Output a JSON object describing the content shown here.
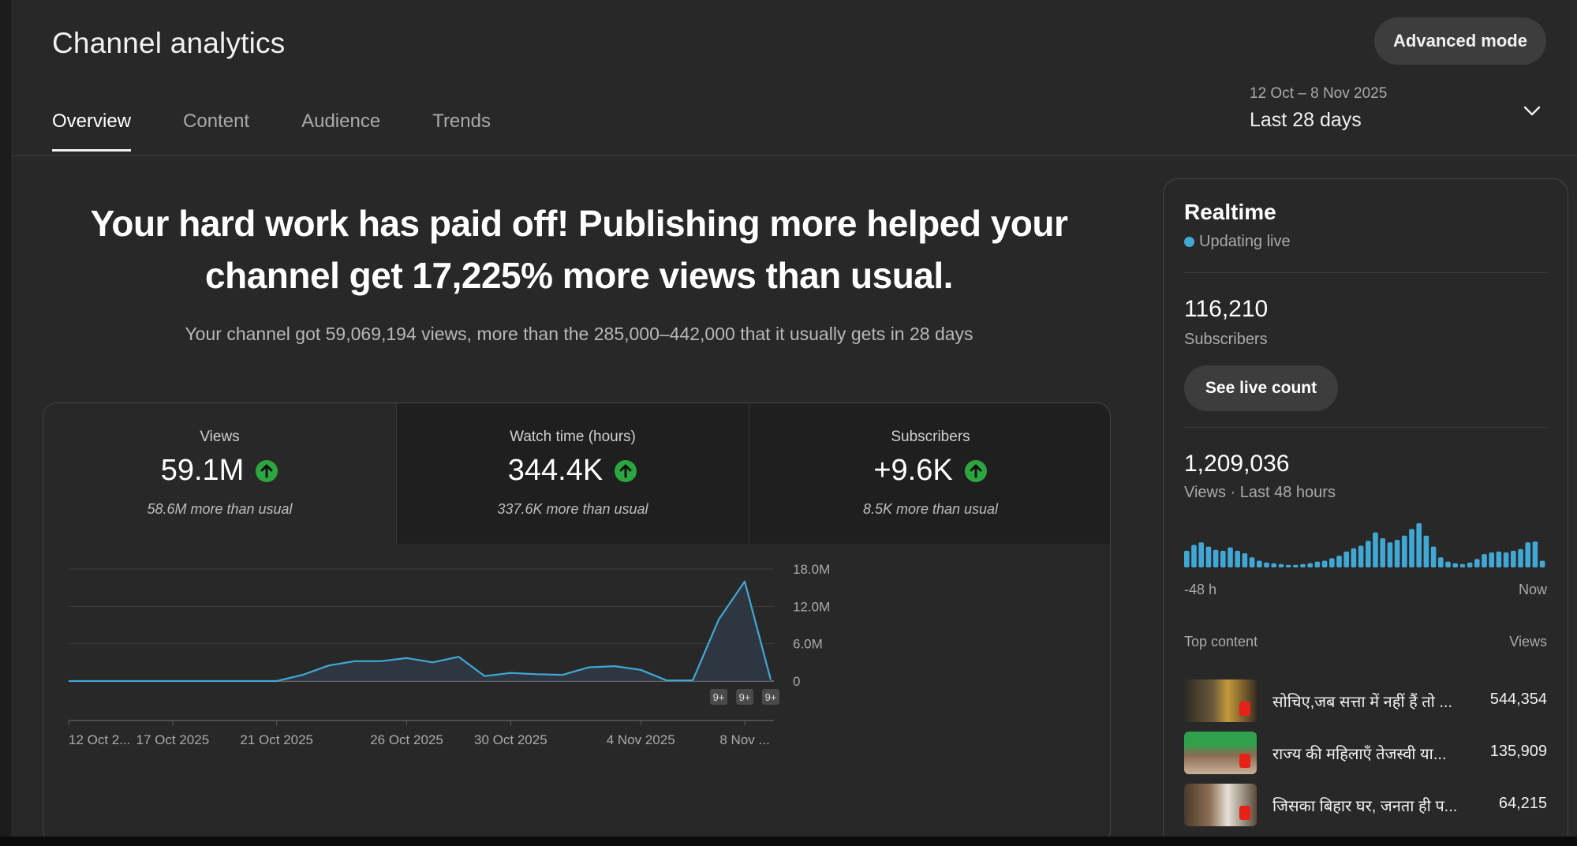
{
  "header": {
    "title": "Channel analytics",
    "advanced_label": "Advanced mode"
  },
  "tabs": [
    {
      "label": "Overview"
    },
    {
      "label": "Content"
    },
    {
      "label": "Audience"
    },
    {
      "label": "Trends"
    }
  ],
  "date": {
    "range": "12 Oct – 8 Nov 2025",
    "label": "Last 28 days"
  },
  "summary": {
    "headline_1": "Your hard work has paid off! Publishing more helped your",
    "headline_2": "channel get 17,225% more views than usual.",
    "subline": "Your channel got 59,069,194 views, more than the 285,000–442,000 that it usually gets in 28 days"
  },
  "metrics": [
    {
      "label": "Views",
      "value": "59.1M",
      "note": "58.6M more than usual"
    },
    {
      "label": "Watch time (hours)",
      "value": "344.4K",
      "note": "337.6K more than usual"
    },
    {
      "label": "Subscribers",
      "value": "+9.6K",
      "note": "8.5K more than usual"
    }
  ],
  "colors": {
    "accent": "#41a8d6",
    "up": "#2ba640",
    "background": "#282828"
  },
  "chart_data": {
    "type": "area",
    "ylim": [
      0,
      18000000
    ],
    "y_ticks": [
      0,
      6000000,
      12000000,
      18000000
    ],
    "y_tick_labels": [
      "0",
      "6.0M",
      "12.0M",
      "18.0M"
    ],
    "x_tick_labels": [
      "12 Oct 2...",
      "17 Oct 2025",
      "21 Oct 2025",
      "26 Oct 2025",
      "30 Oct 2025",
      "4 Nov 2025",
      "8 Nov ..."
    ],
    "x_tick_index": [
      0,
      4,
      8,
      13,
      17,
      22,
      26
    ],
    "values": [
      0,
      0,
      0,
      0,
      0,
      0,
      0,
      0,
      0,
      1000000,
      2500000,
      3200000,
      3200000,
      3700000,
      3000000,
      3900000,
      800000,
      1300000,
      1100000,
      1000000,
      2200000,
      2400000,
      1800000,
      100000,
      100000,
      9900000,
      16000000,
      200000
    ],
    "markers": [
      {
        "index": 25,
        "label": "9+"
      },
      {
        "index": 26,
        "label": "9+"
      },
      {
        "index": 27,
        "label": "9+"
      }
    ]
  },
  "realtime": {
    "title": "Realtime",
    "status": "Updating live",
    "subscribers": "116,210",
    "subscribers_label": "Subscribers",
    "live_button": "See live count",
    "views": "1,209,036",
    "views_label": "Views · Last 48 hours",
    "axis_start": "-48 h",
    "axis_end": "Now",
    "bars": [
      20,
      27,
      30,
      25,
      21,
      20,
      24,
      20,
      17,
      12,
      8,
      6,
      5,
      4,
      3,
      3,
      4,
      5,
      7,
      8,
      11,
      14,
      19,
      23,
      26,
      32,
      42,
      35,
      30,
      33,
      38,
      46,
      53,
      38,
      25,
      12,
      7,
      5,
      4,
      6,
      10,
      16,
      18,
      19,
      18,
      20,
      22,
      30,
      31,
      8
    ],
    "top_content_label": "Top content",
    "top_views_label": "Views",
    "top_content": [
      {
        "title": "सोचिए,जब सत्ता में नहीं हैं तो ...",
        "views": "544,354"
      },
      {
        "title": "राज्य की महिलाएँ तेजस्वी या...",
        "views": "135,909"
      },
      {
        "title": "जिसका बिहार घर, जनता ही प...",
        "views": "64,215"
      }
    ]
  }
}
